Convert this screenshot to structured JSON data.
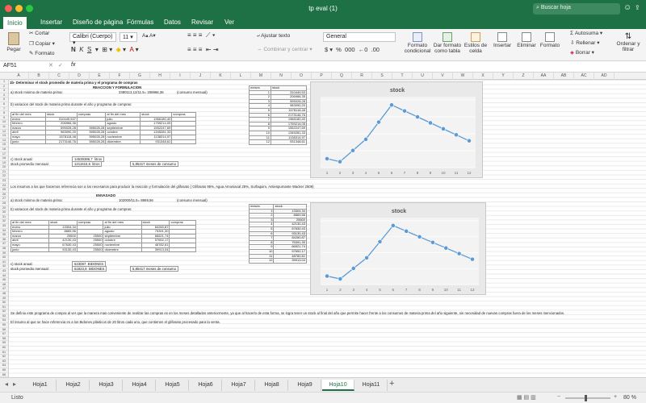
{
  "window": {
    "title": "tp eval (1)",
    "search_placeholder": "Buscar hoja"
  },
  "ribbon_tabs": [
    "Inicio",
    "Insertar",
    "Diseño de página",
    "Fórmulas",
    "Datos",
    "Revisar",
    "Ver"
  ],
  "ribbon": {
    "paste": "Pegar",
    "cut": "Cortar",
    "copy": "Copiar",
    "format_painter": "Formato",
    "font": "Calibri (Cuerpo)",
    "size": "11",
    "wrap": "Ajustar texto",
    "merge": "Combinar y centrar",
    "number_format": "General",
    "cond_format": "Formato condicional",
    "table_format": "Dar formato como tabla",
    "cell_styles": "Estilos de celda",
    "insert": "Insertar",
    "delete": "Eliminar",
    "format": "Formato",
    "autosum": "Autosuma",
    "fill": "Rellenar",
    "clear": "Borrar",
    "sort_filter": "Ordenar y filtrar"
  },
  "formula_bar": {
    "name_box": "AF51",
    "fx": "fx",
    "value": ""
  },
  "columns": [
    "A",
    "B",
    "C",
    "D",
    "E",
    "F",
    "G",
    "H",
    "I",
    "J",
    "K",
    "L",
    "M",
    "N",
    "O",
    "P",
    "Q",
    "R",
    "S",
    "T",
    "U",
    "V",
    "W",
    "X",
    "Y",
    "Z",
    "AA",
    "AB",
    "AC",
    "AD"
  ],
  "sheet": {
    "title1": "1b- Determinar el stock promedio de materia prima y el programa de compras",
    "reaccion": "REACCION Y FORMULACION",
    "a_label": "a) stock minimo de materia prima:",
    "a_value": "2380113,12/11.5= 206966,36",
    "a_note": "(consumo mensual)",
    "b_label": "b) variacion del stock de materia prima durante el año y programa de compras:",
    "hdr": [
      "al fin del mes",
      "stock",
      "compras",
      "al fin del mes",
      "stock",
      "compras"
    ],
    "table1": [
      [
        "enero",
        "310449,537",
        "",
        "julio",
        "1966180,40",
        ""
      ],
      [
        "febrero",
        "206966,36",
        "",
        "agosto",
        "1759214,05",
        ""
      ],
      [
        "marzo",
        "595028,28",
        "595028,28",
        "septiembre",
        "1552247,69",
        ""
      ],
      [
        "abril",
        "983090,20",
        "595028,28",
        "octubre",
        "1345281,33",
        ""
      ],
      [
        "mayo",
        "1578118,48",
        "595028,28",
        "noviembre",
        "1138314,97",
        ""
      ],
      [
        "junio",
        "2173146,76",
        "595028,28",
        "diciembre",
        "931348,61",
        ""
      ]
    ],
    "c_label": "c) stock anual:",
    "c_value": "14539386,7",
    "c_unit": "litros",
    "d_label": "stock promedio mensual:",
    "d_value": "1211615,6",
    "d_unit": "litros",
    "d_extra": "5,85417",
    "d_extra_unit": "meses de consumo",
    "note_insumos": "Los insumos a los que hacemos referencia son a los necesarios para producir la reacción y formulación del glifosato ( Glifosato 95%, Agua Amoniacal 25%, Surfaquim, Antiespumante Wacker 2509)",
    "envasado": "ENVASADO",
    "a2_label": "a) stock minimo de materia prima:",
    "a2_value": "102000/11.5= 8869,56",
    "a2_note": "(consumo mensual)",
    "b2_label": "b) variacion del stock de materia prima durante el año y programa de compras:",
    "table2": [
      [
        "enero",
        "13304,34",
        "",
        "julio",
        "84260,87",
        ""
      ],
      [
        "febrero",
        "8869,56",
        "",
        "agosto",
        "75391,30",
        ""
      ],
      [
        "marzo",
        "25500",
        "25500",
        "septiembre",
        "66521,74",
        ""
      ],
      [
        "abril",
        "42130,43",
        "25500",
        "octubre",
        "57652,17",
        ""
      ],
      [
        "mayo",
        "67630,43",
        "25500",
        "noviembre",
        "48782,61",
        ""
      ],
      [
        "junio",
        "93130,43",
        "25500",
        "diciembre",
        "39913,04",
        ""
      ]
    ],
    "c2_label": "c) stock anual:",
    "c2_value": "623087",
    "c2_unit": "BIDONES",
    "d2_label": "stock promedio mensual:",
    "d2_value": "51923,9",
    "d2_unit": "BIDONES",
    "d2_extra": "5,85417",
    "d2_extra_unit": "meses de consumo",
    "conclusion1": "Se definio este programa de compra al ver que la manera mas conveniente de realizar las compras es en los meses detallados anteriormente, ya que al hacerlo de esta forma, se logra tener un stock al final del año que permite hacer frente a los consumos de materia prima del año siguiente, sin necesidad de nuevas compras fuera de los meses mencionados.",
    "conclusion2": "El insumo al que se hace referencia es a los Bidones plásticos de 20 litros cada uno, que contienen el glifosato procesado para la venta.",
    "mt_hdr": [
      "meses",
      "stock"
    ],
    "mt1": [
      [
        "1",
        "310449,53"
      ],
      [
        "2",
        "206966,35"
      ],
      [
        "3",
        "595028,28"
      ],
      [
        "4",
        "983090,20"
      ],
      [
        "5",
        "1578118,48"
      ],
      [
        "6",
        "2173146,76"
      ],
      [
        "7",
        "1966180,40"
      ],
      [
        "8",
        "1759214,05"
      ],
      [
        "9",
        "1552247,69"
      ],
      [
        "10",
        "1345281,33"
      ],
      [
        "11",
        "1138314,97"
      ],
      [
        "12",
        "931348,61"
      ]
    ],
    "mt2": [
      [
        "1",
        "13304,34"
      ],
      [
        "2",
        "8869,56"
      ],
      [
        "3",
        "25500"
      ],
      [
        "4",
        "42130,43"
      ],
      [
        "5",
        "67630,43"
      ],
      [
        "6",
        "93130,43"
      ],
      [
        "7",
        "84260,87"
      ],
      [
        "8",
        "75391,30"
      ],
      [
        "9",
        "66521,74"
      ],
      [
        "10",
        "57652,17"
      ],
      [
        "11",
        "48782,61"
      ],
      [
        "12",
        "39913,04"
      ]
    ]
  },
  "chart_data": [
    {
      "type": "line",
      "title": "stock",
      "x": [
        1,
        2,
        3,
        4,
        5,
        6,
        7,
        8,
        9,
        10,
        11,
        12
      ],
      "series": [
        {
          "values": [
            310449.53,
            206966.35,
            595028.28,
            983090.2,
            1578118.48,
            2173146.76,
            1966180.4,
            1759214.05,
            1552247.69,
            1345281.33,
            1138314.97,
            931348.61
          ]
        }
      ],
      "color": "#5b9bd5"
    },
    {
      "type": "line",
      "title": "stock",
      "x": [
        1,
        2,
        3,
        4,
        5,
        6,
        7,
        8,
        9,
        10,
        11,
        12
      ],
      "series": [
        {
          "values": [
            13304.34,
            8869.56,
            25500,
            42130.43,
            67630.43,
            93130.43,
            84260.87,
            75391.3,
            66521.74,
            57652.17,
            48782.61,
            39913.04
          ]
        }
      ],
      "color": "#5b9bd5"
    }
  ],
  "sheet_tabs": [
    "Hoja1",
    "Hoja2",
    "Hoja3",
    "Hoja4",
    "Hoja5",
    "Hoja6",
    "Hoja7",
    "Hoja8",
    "Hoja9",
    "Hoja10",
    "Hoja11"
  ],
  "active_sheet": "Hoja10",
  "status": {
    "ready": "Listo",
    "zoom": "80 %"
  }
}
